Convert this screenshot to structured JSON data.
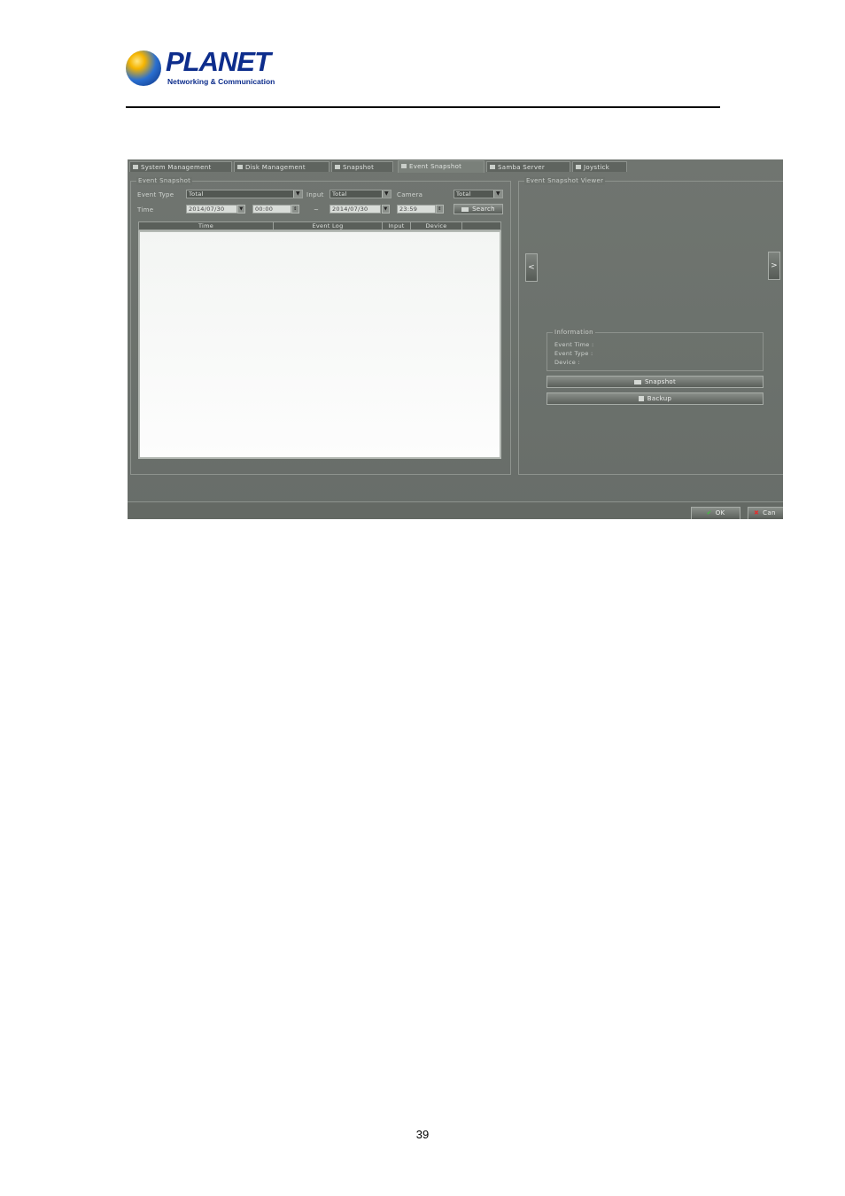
{
  "header": {
    "logo_word": "PLANET",
    "logo_sub": "Networking & Communication"
  },
  "page_number": "39",
  "screenshot": {
    "tabs": [
      {
        "label": "System Management"
      },
      {
        "label": "Disk Management"
      },
      {
        "label": "Snapshot"
      },
      {
        "label": "Event Snapshot"
      },
      {
        "label": "Samba Server"
      },
      {
        "label": "Joystick"
      }
    ],
    "event_snapshot": {
      "group_title": "Event Snapshot",
      "event_type_label": "Event Type",
      "event_type_value": "Total",
      "input_label": "Input",
      "input_value": "Total",
      "camera_label": "Camera",
      "camera_value": "Total",
      "time_label": "Time",
      "start_date": "2014/07/30",
      "start_time": "00:00",
      "range_sep": "~",
      "end_date": "2014/07/30",
      "end_time": "23:59",
      "search_label": "Search",
      "columns": [
        "Time",
        "Event Log",
        "Input",
        "Device"
      ]
    },
    "viewer": {
      "group_title": "Event Snapshot Viewer",
      "prev": "<",
      "next": ">",
      "info_title": "Information",
      "event_time_label": "Event Time :",
      "event_type_label": "Event Type :",
      "device_label": "Device :",
      "snapshot_button": "Snapshot",
      "backup_button": "Backup"
    },
    "footer": {
      "ok_label": "OK",
      "cancel_label": "Can"
    },
    "colors": {
      "ok_check": "#3fbf3f",
      "cancel_x": "#e03030"
    }
  }
}
